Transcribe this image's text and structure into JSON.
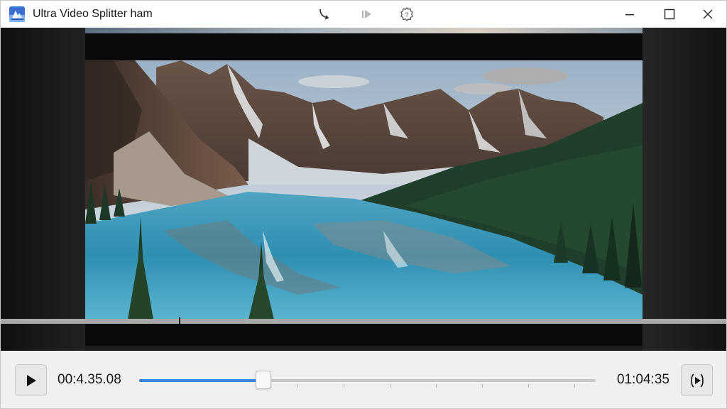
{
  "window": {
    "title": "Ultra Video Splitter ham"
  },
  "titlebar": {
    "tools": [
      {
        "name": "undo-icon"
      },
      {
        "name": "forward-icon"
      },
      {
        "name": "settings-icon"
      }
    ],
    "controls": [
      "minimize-icon",
      "maximize-icon",
      "close-icon"
    ]
  },
  "video": {
    "scene": "mountain-lake-icon"
  },
  "player": {
    "current_time": "00:4.35.08",
    "total_time": "01:04:35",
    "progress": 0.272,
    "play_icon": "play-icon",
    "next_icon": "skip-icon"
  },
  "colors": {
    "accent": "#3d87e0",
    "background": "#f0f0f0",
    "titlebar": "#ffffff"
  }
}
